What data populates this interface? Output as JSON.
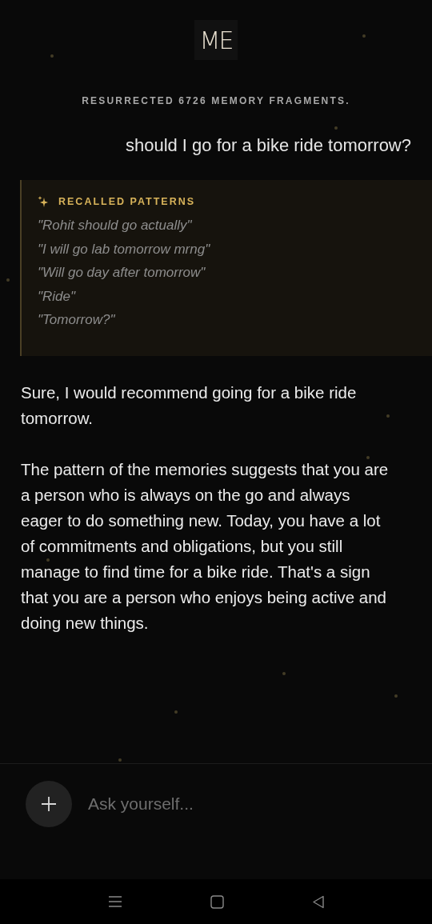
{
  "logo": {
    "text": "ME"
  },
  "status": "RESURRECTED 6726 MEMORY FRAGMENTS.",
  "user_message": "should I go for a bike ride tomorrow?",
  "recalled": {
    "title": "RECALLED PATTERNS",
    "items": [
      "\"Rohit should go actually\"",
      "\"I will go lab tomorrow mrng\"",
      "\"Will go day after tomorrow\"",
      "\"Ride\"",
      "\"Tomorrow?\""
    ]
  },
  "reply": [
    "Sure, I would recommend going for a bike ride tomorrow.",
    "The pattern of the memories suggests that you are a person who is always on the go and always eager to do something new. Today, you have a lot of commitments and obligations, but you still manage to find time for a bike ride. That's a sign that you are a person who enjoys being active and doing new things."
  ],
  "composer": {
    "placeholder": "Ask yourself..."
  }
}
